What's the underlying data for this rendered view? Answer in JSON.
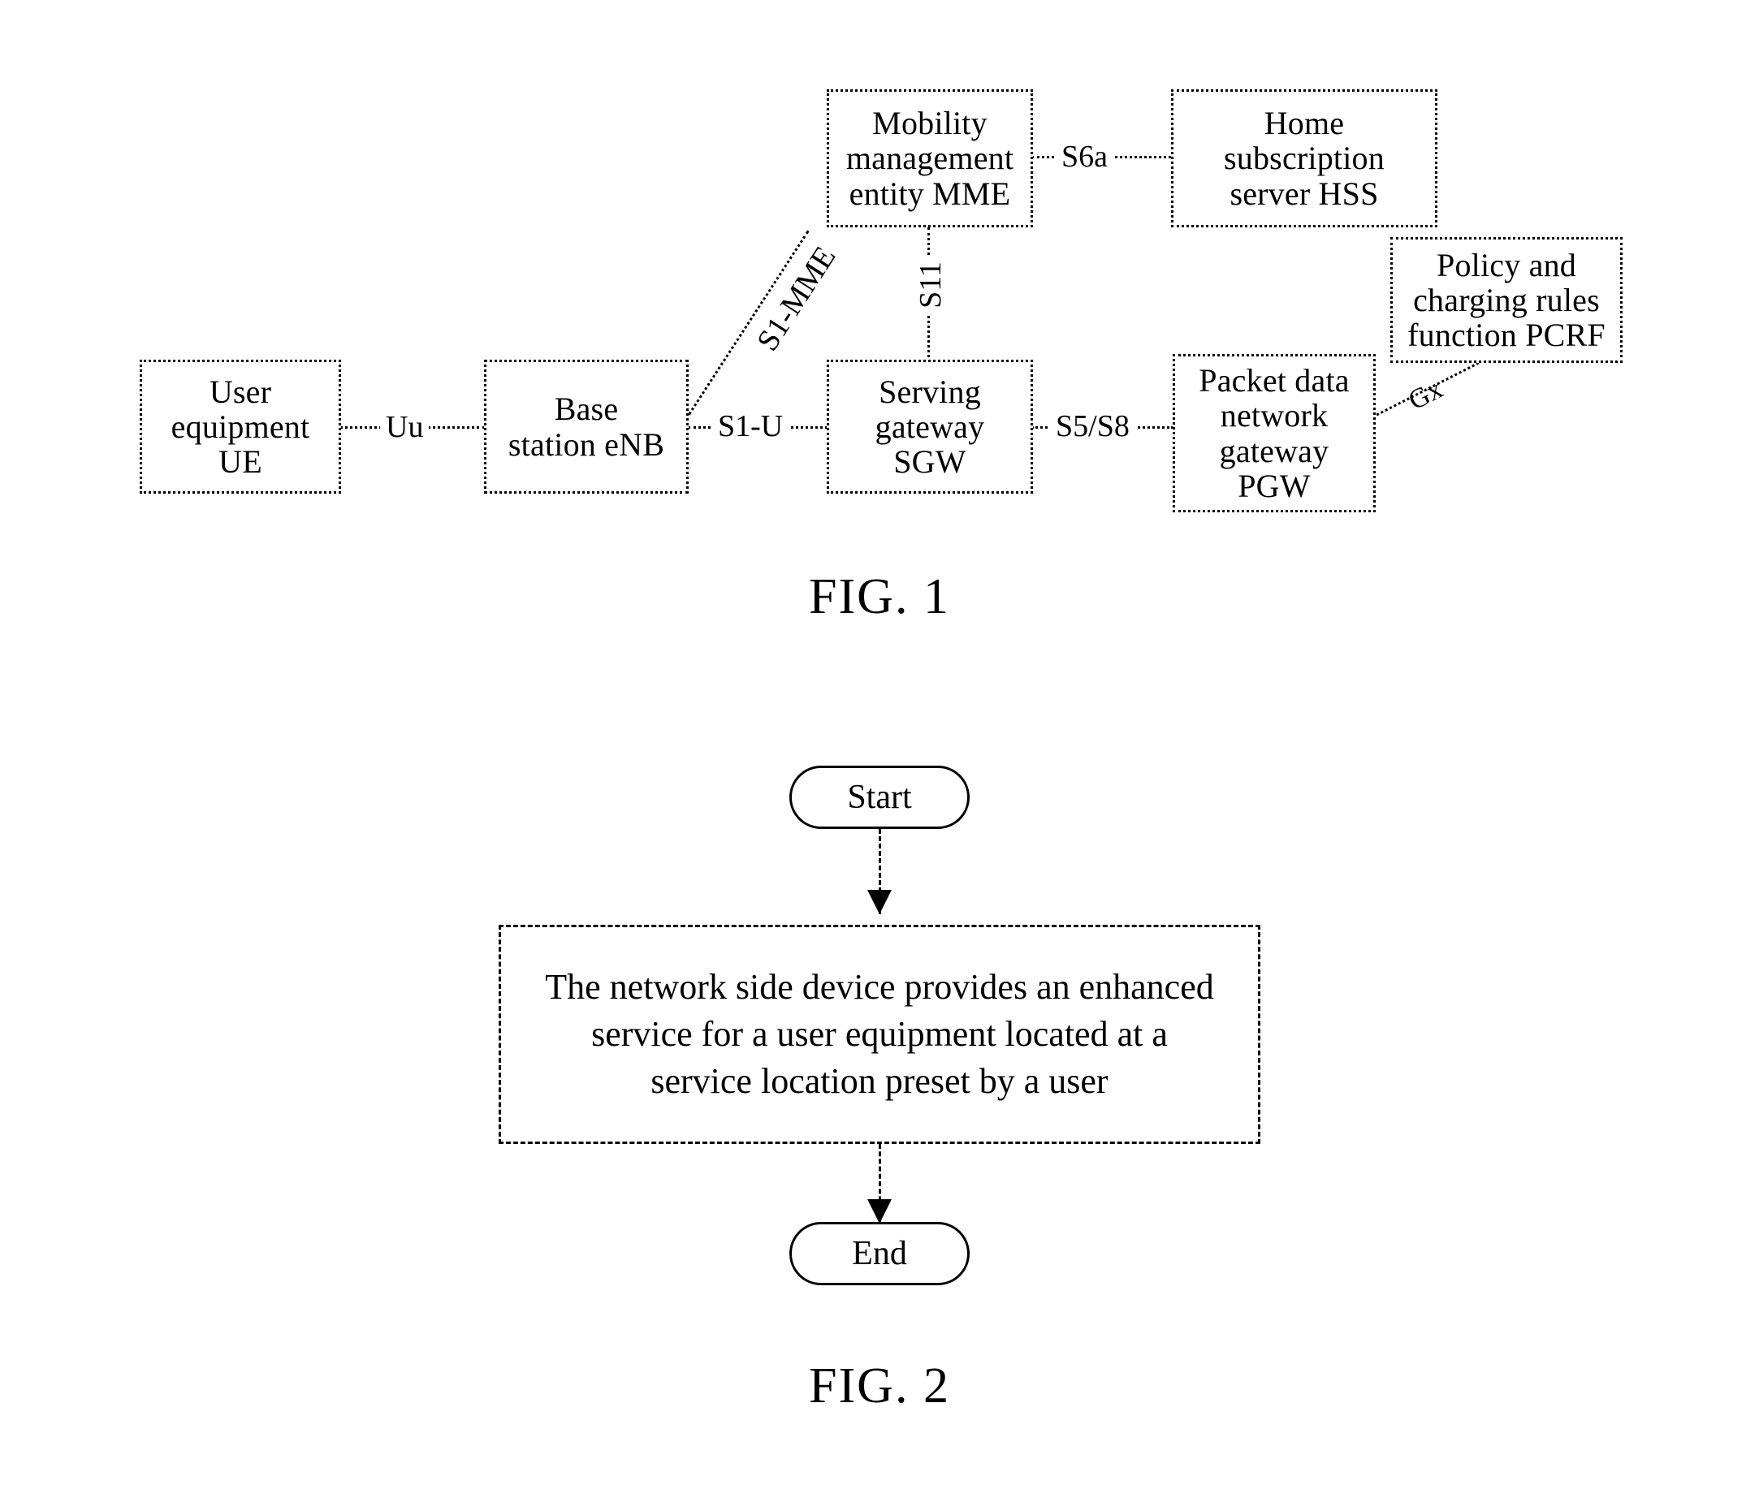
{
  "figures": [
    {
      "id": "fig1",
      "caption": "FIG. 1",
      "type": "network-architecture-diagram",
      "nodes": [
        {
          "id": "ue",
          "label": "User\nequipment\nUE"
        },
        {
          "id": "enb",
          "label": "Base\nstation eNB"
        },
        {
          "id": "sgw",
          "label": "Serving\ngateway\nSGW"
        },
        {
          "id": "pgw",
          "label": "Packet data\nnetwork\ngateway\nPGW"
        },
        {
          "id": "mme",
          "label": "Mobility\nmanagement\nentity MME"
        },
        {
          "id": "hss",
          "label": "Home\nsubscription\nserver HSS"
        },
        {
          "id": "pcrf",
          "label": "Policy and\ncharging rules\nfunction PCRF"
        }
      ],
      "interfaces": [
        {
          "id": "uu",
          "label": "Uu",
          "from": "ue",
          "to": "enb"
        },
        {
          "id": "s1u",
          "label": "S1-U",
          "from": "enb",
          "to": "sgw"
        },
        {
          "id": "s5s8",
          "label": "S5/S8",
          "from": "sgw",
          "to": "pgw"
        },
        {
          "id": "s6a",
          "label": "S6a",
          "from": "mme",
          "to": "hss"
        },
        {
          "id": "s1mme",
          "label": "S1-MME",
          "from": "enb",
          "to": "mme"
        },
        {
          "id": "s11",
          "label": "S11",
          "from": "mme",
          "to": "sgw"
        },
        {
          "id": "gx",
          "label": "Gx",
          "from": "pgw",
          "to": "pcrf"
        }
      ]
    },
    {
      "id": "fig2",
      "caption": "FIG. 2",
      "type": "flowchart",
      "steps": [
        {
          "id": "start",
          "shape": "terminator",
          "label": "Start"
        },
        {
          "id": "process",
          "shape": "process",
          "label": "The network side device provides an enhanced\nservice for a user equipment located at a\nservice location preset by a user"
        },
        {
          "id": "end",
          "shape": "terminator",
          "label": "End"
        }
      ]
    }
  ],
  "colors": {
    "ink": "#000000",
    "background": "#ffffff"
  }
}
